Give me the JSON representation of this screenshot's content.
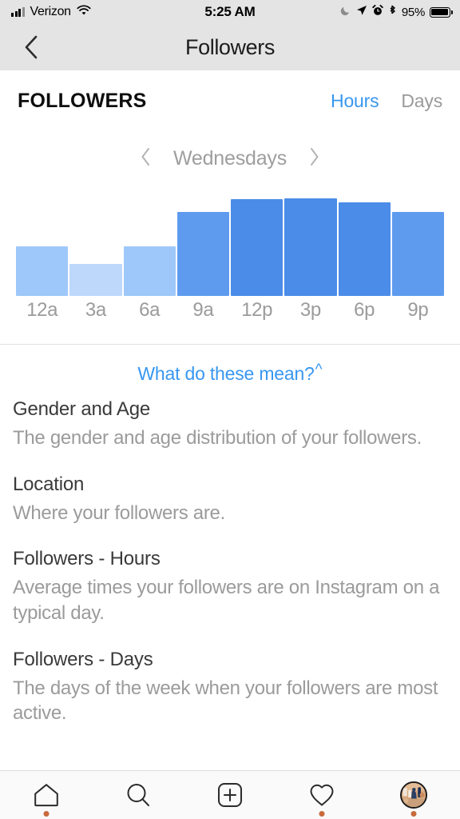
{
  "status_bar": {
    "carrier": "Verizon",
    "wifi_icon": "wifi-icon",
    "time": "5:25 AM",
    "moon_icon": "moon-icon",
    "location_icon": "location-arrow-icon",
    "alarm_icon": "alarm-clock-icon",
    "bluetooth_icon": "bluetooth-icon",
    "battery_percent": "95%"
  },
  "nav": {
    "back_icon": "chevron-left-icon",
    "title": "Followers"
  },
  "section": {
    "title": "FOLLOWERS",
    "segments": [
      {
        "label": "Hours",
        "active": true
      },
      {
        "label": "Days",
        "active": false
      }
    ],
    "active_color": "#3897f0",
    "inactive_color": "#9a9a9a"
  },
  "day_selector": {
    "prev_icon": "chevron-left-icon",
    "label": "Wednesdays",
    "next_icon": "chevron-right-icon"
  },
  "chart_data": {
    "type": "bar",
    "title": "FOLLOWERS",
    "subtitle": "Wednesdays",
    "xlabel": "",
    "ylabel": "",
    "grid": false,
    "legend": false,
    "categories": [
      "12a",
      "3a",
      "6a",
      "9a",
      "12p",
      "3p",
      "6p",
      "9p"
    ],
    "values": [
      48,
      31,
      48,
      81,
      93,
      94,
      90,
      81
    ],
    "ylim": [
      0,
      100
    ],
    "bar_colors": [
      "#9ec8f9",
      "#bdd8fb",
      "#9ec8f9",
      "#5e9bee",
      "#4a8ce8",
      "#4a8ce8",
      "#4a8ce8",
      "#5e9bee"
    ],
    "tick_color": "#9b9b9b"
  },
  "explain_link": {
    "text": "What do these mean?",
    "caret": "^",
    "color": "#3897f0"
  },
  "definitions": [
    {
      "term": "Gender and Age",
      "description": "The gender and age distribution of your followers."
    },
    {
      "term": "Location",
      "description": "Where your followers are."
    },
    {
      "term": "Followers - Hours",
      "description": "Average times your followers are on Instagram on a typical day."
    },
    {
      "term": "Followers - Days",
      "description": "The days of the week when your followers are most active."
    }
  ],
  "tab_bar": [
    {
      "name": "home-icon",
      "label": "Home",
      "badge": true
    },
    {
      "name": "search-icon",
      "label": "Search",
      "badge": false
    },
    {
      "name": "plus-square-icon",
      "label": "Add",
      "badge": false
    },
    {
      "name": "heart-icon",
      "label": "Activity",
      "badge": true
    },
    {
      "name": "profile-avatar",
      "label": "Profile",
      "badge": true
    }
  ],
  "badge_color": "#c86a3c"
}
